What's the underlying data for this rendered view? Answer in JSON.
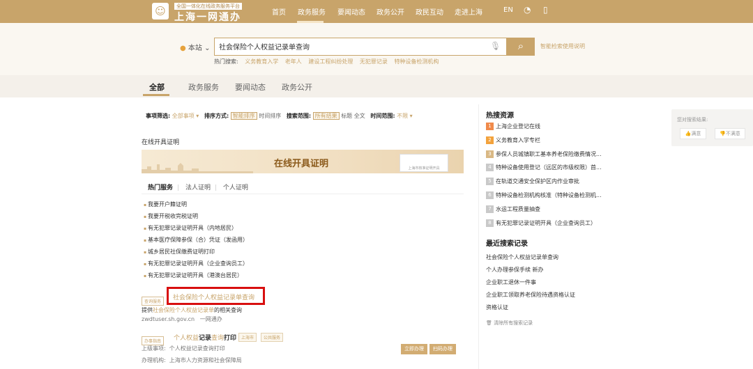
{
  "header": {
    "logo_tag": "全国一体化在线政务服务平台",
    "logo_text": "上海一网通办",
    "nav": [
      "首页",
      "政务服务",
      "要闻动态",
      "政务公开",
      "政民互动",
      "走进上海"
    ],
    "lang": "EN",
    "brand_color": "#c8a46a"
  },
  "search": {
    "site": "本站",
    "query": "社会保险个人权益记录单查询",
    "smart_link": "智能检索使用说明",
    "hot_label": "热门搜索:",
    "hot_items": [
      "义务教育入学",
      "老年人",
      "建设工程纠纷处理",
      "无犯罪记录",
      "特种设备检测机构"
    ]
  },
  "tabs": [
    "全部",
    "政务服务",
    "要闻动态",
    "政务公开"
  ],
  "filters": {
    "item_label": "事项筛选:",
    "item_value": "全部事项",
    "sort_label": "排序方式:",
    "sort_active": "智能排序",
    "sort_alt": "时间排序",
    "range_label": "搜索范围:",
    "range_active": "所有结果",
    "range_title": "标题",
    "range_full": "全文",
    "time_label": "时间范围:",
    "time_value": "不限"
  },
  "section": {
    "title": "在线开具证明",
    "banner_title": "在线开具证明",
    "banner_doc": "上海市核准证明开具"
  },
  "service_tabs": [
    "热门服务",
    "法人证明",
    "个人证明"
  ],
  "services": [
    "我要开户籍证明",
    "我要开税收完税证明",
    "有无犯罪记录证明开具（内地居民）",
    "基本医疗保障参保（合）凭证（发函用）",
    "城乡居民社保缴费证明打印",
    "有无犯罪记录证明开具（企业查询员工）",
    "有无犯罪记录证明开具（港澳台居民）"
  ],
  "result1": {
    "tag": "查询服务",
    "title": "社会保险个人权益记录单查询",
    "desc_prefix": "提供",
    "desc_hl": "社会保险个人权益记录单",
    "desc_suffix": "的相关查询",
    "url": "zwdtuser.sh.gov.cn",
    "source": "一网通办"
  },
  "result2": {
    "tag": "办事指南",
    "title_a": "个人权益",
    "title_b": "记录",
    "title_c": "查询",
    "title_d": "打印",
    "tag_a": "上海市",
    "tag_b": "公共服务",
    "upper_label": "上级事项:",
    "upper_value": "个人权益记录查询打印",
    "org_label": "办理机构:",
    "org_value": "上海市人力资源和社会保障局",
    "btn_now": "立即办理",
    "btn_scan": "扫码办理"
  },
  "sidebar": {
    "hot_title": "热搜资源",
    "hot": [
      {
        "num": "1",
        "text": "上海企业登记在线",
        "color": "#f08a4b"
      },
      {
        "num": "2",
        "text": "义务教育入学专栏",
        "color": "#f3a23c"
      },
      {
        "num": "3",
        "text": "参保人员城镇职工基本养老保险缴费情况...",
        "color": "#d9b884"
      },
      {
        "num": "4",
        "text": "特种设备使用登记（远区的市级权限）首...",
        "color": "#c9c9c9"
      },
      {
        "num": "5",
        "text": "在轨道交通安全保护区内作业审批",
        "color": "#c9c9c9"
      },
      {
        "num": "6",
        "text": "特种设备检测机构核准（特种设备检测机...",
        "color": "#c9c9c9"
      },
      {
        "num": "7",
        "text": "水运工程质量抽查",
        "color": "#c9c9c9"
      },
      {
        "num": "8",
        "text": "有无犯罪记录证明开具（企业查询员工）",
        "color": "#c9c9c9"
      }
    ],
    "recent_title": "最近搜索记录",
    "recent": [
      "社会保险个人权益记录单查询",
      "个人办理参保手续 新办",
      "企业职工退休一件事",
      "企业职工领取养老保险待遇资格认证",
      "资格认证"
    ],
    "clear": "清除所有搜索记录"
  },
  "feedback": {
    "title": "您对搜索结果:",
    "good": "满意",
    "bad": "不满意"
  }
}
